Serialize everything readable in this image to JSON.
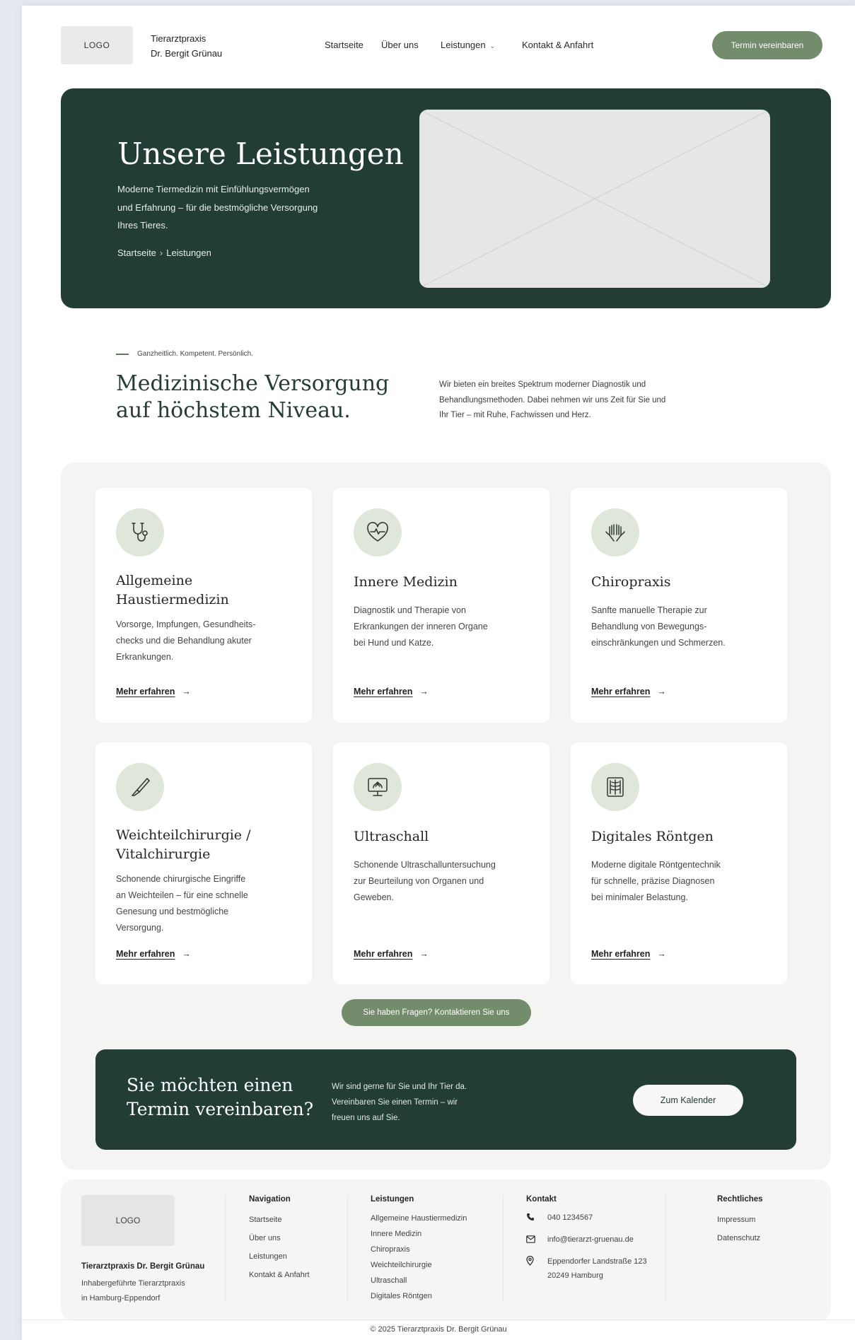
{
  "header": {
    "logo": "LOGO",
    "brand_line1": "Tierarztpraxis",
    "brand_line2": "Dr. Bergit Grünau",
    "nav": [
      {
        "label": "Startseite"
      },
      {
        "label": "Über uns"
      },
      {
        "label": "Leistungen",
        "has_dropdown": true
      },
      {
        "label": "Kontakt & Anfahrt"
      }
    ],
    "cta": "Termin vereinbaren"
  },
  "hero": {
    "title": "Unsere Leistungen",
    "subtitle_line1": "Moderne Tiermedizin mit Einfühlungsvermögen",
    "subtitle_line2": "und Erfahrung – für die bestmögliche Versorgung",
    "subtitle_line3": "Ihres Tieres.",
    "breadcrumb": [
      "Startseite",
      "Leistungen"
    ],
    "breadcrumb_sep": "›"
  },
  "intro": {
    "eyebrow": "Ganzheitlich. Kompetent. Persönlich.",
    "title_line1": "Medizinische Versorgung",
    "title_line2": "auf höchstem Niveau.",
    "text_line1": "Wir bieten ein breites Spektrum moderner Diagnostik und",
    "text_line2": "Behandlungsmethoden. Dabei nehmen wir uns Zeit für Sie und",
    "text_line3": "Ihr Tier – mit Ruhe, Fachwissen und Herz."
  },
  "services": [
    {
      "icon": "stethoscope-icon",
      "title_lines": [
        "Allgemeine",
        "Haustiermedizin"
      ],
      "desc_lines": [
        "Vorsorge, Impfungen, Gesundheits-",
        "checks und die Behandlung akuter",
        "Erkrankungen."
      ],
      "link": "Mehr erfahren"
    },
    {
      "icon": "heart-pulse-icon",
      "title_lines": [
        "Innere Medizin"
      ],
      "desc_lines": [
        "Diagnostik und Therapie von",
        "Erkrankungen der inneren Organe",
        "bei Hund und Katze."
      ],
      "link": "Mehr erfahren"
    },
    {
      "icon": "hands-icon",
      "title_lines": [
        "Chiropraxis"
      ],
      "desc_lines": [
        "Sanfte manuelle Therapie zur",
        "Behandlung von Bewegungs-",
        "einschränkungen und Schmerzen."
      ],
      "link": "Mehr erfahren"
    },
    {
      "icon": "scalpel-icon",
      "title_lines": [
        "Weichteilchirurgie /",
        "Vitalchirurgie"
      ],
      "desc_lines": [
        "Schonende chirurgische Eingriffe",
        "an Weichteilen – für eine schnelle",
        "Genesung und bestmögliche",
        "Versorgung."
      ],
      "link": "Mehr erfahren"
    },
    {
      "icon": "ultrasound-monitor-icon",
      "title_lines": [
        "Ultraschall"
      ],
      "desc_lines": [
        "Schonende Ultraschalluntersuchung",
        "zur Beurteilung von Organen und",
        "Geweben."
      ],
      "link": "Mehr erfahren"
    },
    {
      "icon": "xray-icon",
      "title_lines": [
        "Digitales Röntgen"
      ],
      "desc_lines": [
        "Moderne digitale Röntgentechnik",
        "für schnelle, präzise Diagnosen",
        "bei minimaler Belastung."
      ],
      "link": "Mehr erfahren"
    }
  ],
  "link_arrow": "→",
  "contact_pill": "Sie haben Fragen? Kontaktieren Sie uns",
  "banner": {
    "title_line1": "Sie möchten einen",
    "title_line2": "Termin vereinbaren?",
    "text_line1": "Wir sind gerne für Sie und Ihr Tier da.",
    "text_line2": "Vereinbaren Sie einen Termin – wir",
    "text_line3": "freuen uns auf Sie.",
    "button": "Zum Kalender"
  },
  "footer": {
    "logo": "LOGO",
    "name": "Tierarztpraxis Dr. Bergit Grünau",
    "tag_line1": "Inhabergeführte Tierarztpraxis",
    "tag_line2": "in Hamburg-Eppendorf",
    "navigation": {
      "heading": "Navigation",
      "items": [
        "Startseite",
        "Über uns",
        "Leistungen",
        "Kontakt & Anfahrt"
      ]
    },
    "services": {
      "heading": "Leistungen",
      "items": [
        "Allgemeine Haustiermedizin",
        "Innere Medizin",
        "Chiropraxis",
        "Weichteilchirurgie",
        "Ultraschall",
        "Digitales Röntgen"
      ]
    },
    "contact": {
      "heading": "Kontakt",
      "phone": "040 1234567",
      "email": "info@tierarzt-gruenau.de",
      "address_line1": "Eppendorfer Landstraße 123",
      "address_line2": "20249 Hamburg"
    },
    "legal": {
      "heading": "Rechtliches",
      "items": [
        "Impressum",
        "Datenschutz"
      ]
    },
    "copyright": "© 2025 Tierarztpraxis Dr. Bergit Grünau"
  },
  "colors": {
    "dark_green": "#223d35",
    "accent_green": "#738c6b",
    "icon_bg": "#dfe6da",
    "section_bg": "#f4f5f2"
  }
}
